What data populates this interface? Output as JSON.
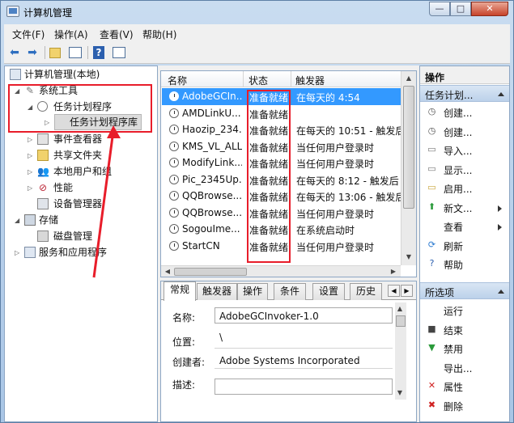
{
  "window": {
    "title": "计算机管理",
    "min_label": "—",
    "max_label": "□",
    "close_label": "✕"
  },
  "menu": [
    "文件(F)",
    "操作(A)",
    "查看(V)",
    "帮助(H)"
  ],
  "toolbar": {
    "help_label": "?"
  },
  "tree": {
    "root": "计算机管理(本地)",
    "system_tools": "系统工具",
    "task_scheduler": "任务计划程序",
    "task_library": "任务计划程序库",
    "event_viewer": "事件查看器",
    "shared_folders": "共享文件夹",
    "local_users": "本地用户和组",
    "performance": "性能",
    "device_manager": "设备管理器",
    "storage": "存储",
    "disk_management": "磁盘管理",
    "services_apps": "服务和应用程序"
  },
  "list": {
    "columns": [
      "名称",
      "状态",
      "触发器"
    ],
    "rows": [
      {
        "name": "AdobeGCIn...",
        "status": "准备就绪",
        "trigger": "在每天的 4:54"
      },
      {
        "name": "AMDLinkU...",
        "status": "准备就绪",
        "trigger": ""
      },
      {
        "name": "Haozip_234...",
        "status": "准备就绪",
        "trigger": "在每天的 10:51 - 触发后"
      },
      {
        "name": "KMS_VL_ALL",
        "status": "准备就绪",
        "trigger": "当任何用户登录时"
      },
      {
        "name": "ModifyLink...",
        "status": "准备就绪",
        "trigger": "当任何用户登录时"
      },
      {
        "name": "Pic_2345Up...",
        "status": "准备就绪",
        "trigger": "在每天的 8:12 - 触发后"
      },
      {
        "name": "QQBrowse...",
        "status": "准备就绪",
        "trigger": "在每天的 13:06 - 触发后"
      },
      {
        "name": "QQBrowse...",
        "status": "准备就绪",
        "trigger": "当任何用户登录时"
      },
      {
        "name": "SogouIme...",
        "status": "准备就绪",
        "trigger": "在系统启动时"
      },
      {
        "name": "StartCN",
        "status": "准备就绪",
        "trigger": "当任何用户登录时"
      }
    ]
  },
  "detail": {
    "tabs": [
      "常规",
      "触发器",
      "操作",
      "条件",
      "设置",
      "历史"
    ],
    "name_label": "名称:",
    "name_value": "AdobeGCInvoker-1.0",
    "location_label": "位置:",
    "location_value": "\\",
    "author_label": "创建者:",
    "author_value": "Adobe Systems Incorporated",
    "desc_label": "描述:"
  },
  "actions": {
    "title": "操作",
    "group1": "任务计划...",
    "group1_items": [
      "创建...",
      "创建...",
      "导入...",
      "显示...",
      "启用...",
      "新文...",
      "查看",
      "刷新",
      "帮助"
    ],
    "group2": "所选项",
    "group2_items": [
      "运行",
      "结束",
      "禁用",
      "导出...",
      "属性",
      "删除"
    ]
  },
  "colors": {
    "selection": "#3399ff",
    "annotation": "#e81d2a"
  }
}
